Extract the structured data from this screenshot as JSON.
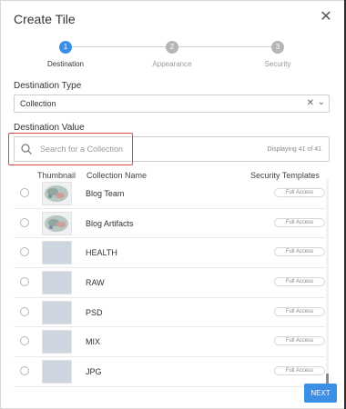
{
  "dialog": {
    "title": "Create Tile",
    "close_icon": "close-icon"
  },
  "stepper": {
    "steps": [
      {
        "number": "1",
        "label": "Destination",
        "active": true
      },
      {
        "number": "2",
        "label": "Appearance",
        "active": false
      },
      {
        "number": "3",
        "label": "Security",
        "active": false
      }
    ],
    "active_color": "#3b8fe6",
    "inactive_color": "#b5b5b5"
  },
  "destination_type": {
    "label": "Destination Type",
    "value": "Collection"
  },
  "destination_value": {
    "label": "Destination Value",
    "search_placeholder": "Search for a Collection",
    "count_text": "Displaying 41 of 41"
  },
  "table": {
    "headers": {
      "thumbnail": "Thumbnail",
      "name": "Collection Name",
      "security": "Security Templates"
    },
    "rows": [
      {
        "name": "Blog Team",
        "security": "Full Access",
        "thumb": "pattern"
      },
      {
        "name": "Blog Artifacts",
        "security": "Full Access",
        "thumb": "pattern"
      },
      {
        "name": "HEALTH",
        "security": "Full Access",
        "thumb": "placeholder"
      },
      {
        "name": "RAW",
        "security": "Full Access",
        "thumb": "placeholder"
      },
      {
        "name": "PSD",
        "security": "Full Access",
        "thumb": "placeholder"
      },
      {
        "name": "MIX",
        "security": "Full Access",
        "thumb": "placeholder"
      },
      {
        "name": "JPG",
        "security": "Full Access",
        "thumb": "placeholder"
      }
    ]
  },
  "footer": {
    "next_label": "NEXT",
    "accent": "#3b8fe6"
  }
}
